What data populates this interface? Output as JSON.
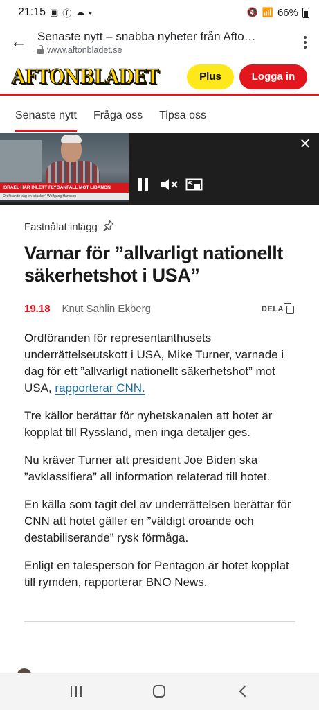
{
  "status_bar": {
    "time": "21:15",
    "battery": "66%"
  },
  "browser": {
    "page_title": "Senaste nytt – snabba nyheter från Afto…",
    "url": "www.aftonbladet.se"
  },
  "site_header": {
    "logo": "AFTONBLADET",
    "plus_label": "Plus",
    "login_label": "Logga in"
  },
  "tabs": [
    {
      "label": "Senaste nytt",
      "active": true
    },
    {
      "label": "Fråga oss",
      "active": false
    },
    {
      "label": "Tipsa oss",
      "active": false
    }
  ],
  "video": {
    "chyron": "ISRAEL HAR INLETT FLYGANFALL MOT LIBANON",
    "chyron_sub": "Ordförande väg en attacker\" Wolfgang Hansson"
  },
  "article": {
    "pinned_label": "Fastnålat inlägg",
    "headline": "Varnar för ”allvarligt nationellt säkerhetshot i USA”",
    "time": "19.18",
    "author": "Knut Sahlin Ekberg",
    "share_label": "DELA",
    "paragraphs": [
      {
        "text": "Ordföranden för representanthusets underrättelseutskott i USA, Mike Turner, varnade i dag för ett ”allvarligt nationellt säkerhetshot” mot USA, ",
        "link": "rapporterar CNN."
      },
      {
        "text": "Tre källor berättar för nyhetskanalen att hotet är kopplat till Ryssland, men inga detaljer ges."
      },
      {
        "text": "Nu kräver Turner att president Joe Biden ska ”avklassifiera” all information relaterad till hotet."
      },
      {
        "text": "En källa som tagit del av underrättelsen berättar för CNN att hotet gäller en ”väldigt oroande och destabiliserande” rysk förmåga."
      },
      {
        "text": "Enligt en talesperson för Pentagon är hotet kopplat till rymden, rapporterar BNO News."
      }
    ]
  },
  "colors": {
    "brand_red": "#e3161d",
    "brand_yellow": "#ffe81a",
    "link_blue": "#1a6fa0"
  }
}
